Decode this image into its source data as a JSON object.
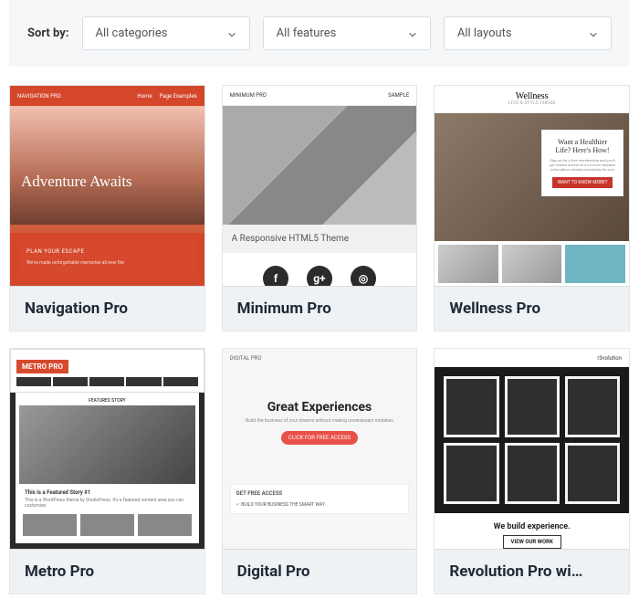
{
  "filters": {
    "label": "Sort by:",
    "categories": "All categories",
    "features": "All features",
    "layouts": "All layouts"
  },
  "themes": [
    {
      "name": "Navigation Pro",
      "thumb": {
        "brand": "NAVIGATION PRO",
        "menu1": "Home",
        "menu2": "Page Examples",
        "headline": "Adventure Awaits",
        "box_title": "PLAN YOUR ESCAPE",
        "box_text": "We've made unforgettable memories all over the"
      }
    },
    {
      "name": "Minimum Pro",
      "thumb": {
        "brand": "MINIMUM PRO",
        "sample": "SAMPLE",
        "caption": "A Responsive HTML5 Theme",
        "icon1": "f",
        "icon2": "g+",
        "icon3": "◎"
      }
    },
    {
      "name": "Wellness Pro",
      "thumb": {
        "brand": "Wellness",
        "tagline": "LIVE & STYLE THEME",
        "card_title": "Want a Healthier Life? Here's How!",
        "card_text": "Sign up for a free membership and you'll get instant access to a lot more valuable information created exclusively for you!",
        "card_btn": "WANT TO KNOW MORE?"
      }
    },
    {
      "name": "Metro Pro",
      "thumb": {
        "brand": "METRO PRO",
        "featured_lbl": "FEATURED STORY",
        "story": "This is a Featured Story #1",
        "body": "This is a WordPress theme by StudioPress. It's a featured content area you can customize."
      }
    },
    {
      "name": "Digital Pro",
      "thumb": {
        "brand": "DIGITAL PRO",
        "headline": "Great Experiences",
        "subline": "Build the business of your dreams without making unnecessary mistakes",
        "btn": "CLICK FOR FREE ACCESS",
        "section": "GET FREE ACCESS",
        "bullet": "BUILD YOUR BUSINESS THE SMART WAY"
      }
    },
    {
      "name": "Revolution Pro wi…",
      "thumb": {
        "brand": "r3volution",
        "footer": "We build experience.",
        "btn": "VIEW OUR WORK"
      }
    }
  ]
}
